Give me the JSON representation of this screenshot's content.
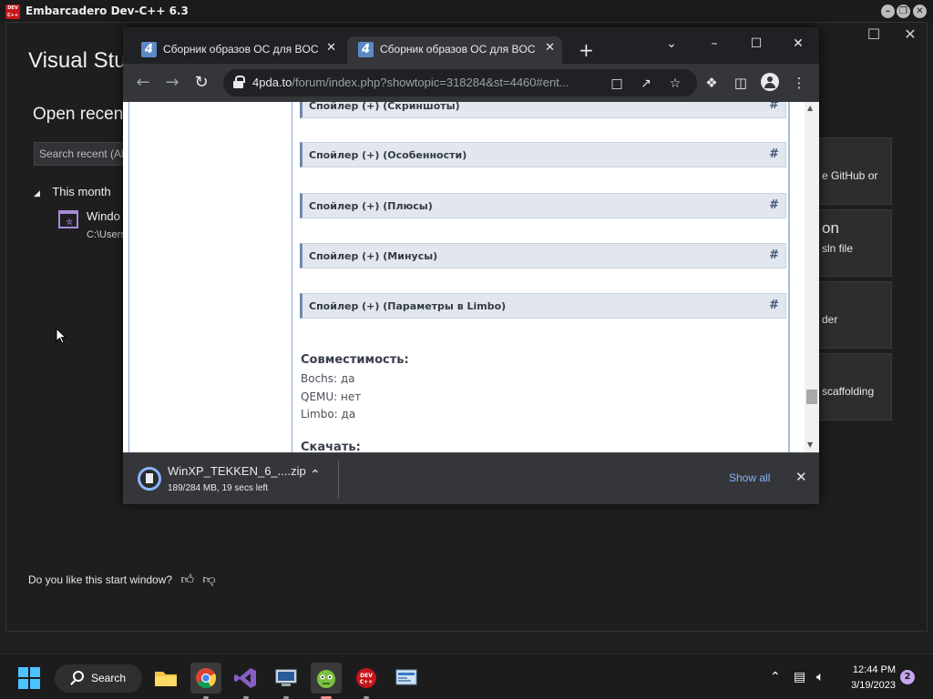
{
  "devcpp": {
    "title": "Embarcadero Dev-C++ 6.3",
    "logo_text": "DEV C++",
    "controls": [
      "–",
      "❐",
      "✕"
    ]
  },
  "vs_start": {
    "title": "Visual Stu",
    "open_recent": "Open recent",
    "search_placeholder": "Search recent (Alt",
    "group_label": "This month",
    "recent_item_name": "Windo",
    "recent_item_path": "C:\\Users",
    "cards": [
      {
        "text": "e GitHub or"
      },
      {
        "title": "on",
        "text": "sln file"
      },
      {
        "text": "der"
      },
      {
        "text": "scaffolding"
      }
    ],
    "feedback": "Do you like this start window?",
    "controls": [
      "–",
      "☐",
      "✕"
    ]
  },
  "chrome": {
    "tabs": [
      {
        "title": "Сборник образов ОС для BOCH",
        "favicon": "4"
      },
      {
        "title": "Сборник образов ОС для BOCH",
        "favicon": "4"
      }
    ],
    "url_host": "4pda.to",
    "url_path": "/forum/index.php?showtopic=318284&st=4460#ent...",
    "page": {
      "spoilers": [
        "Спойлер (+) (Скриншоты)",
        "Спойлер (+) (Особенности)",
        "Спойлер (+) (Плюсы)",
        "Спойлер (+) (Минусы)",
        "Спойлер (+) (Параметры в Limbo)"
      ],
      "spoiler_anchor": "#",
      "compat_title": "Совместимость:",
      "compat": [
        "Bochs: да",
        "QEMU: нет",
        "Limbo: да"
      ],
      "download_title": "Скачать:"
    },
    "download": {
      "filename": "WinXP_TEKKEN_6_....zip",
      "status": "189/284 MB, 19 secs left",
      "show_all": "Show all"
    }
  },
  "taskbar": {
    "search_label": "Search",
    "time": "12:44 PM",
    "date": "3/19/2023",
    "notifications": "2",
    "apps": [
      "file-explorer",
      "chrome",
      "visual-studio",
      "remote-desktop",
      "game",
      "dev-cpp",
      "control-panel"
    ]
  },
  "colors": {
    "accent_blue": "#8ab4f8",
    "spoiler_bg": "#e2e7ef",
    "windows_blue": "#4cc2ff"
  }
}
